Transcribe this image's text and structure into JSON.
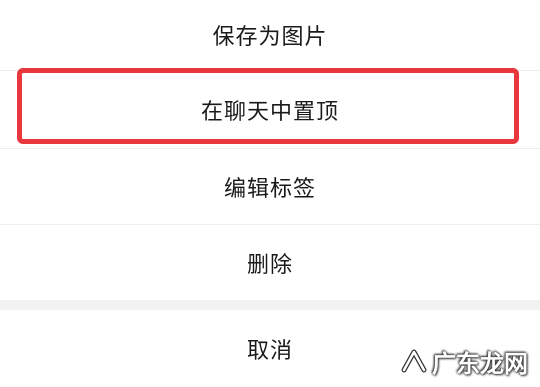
{
  "menu": {
    "items": [
      {
        "label": "保存为图片"
      },
      {
        "label": "在聊天中置顶"
      },
      {
        "label": "编辑标签"
      },
      {
        "label": "删除"
      }
    ],
    "cancel_label": "取消"
  },
  "highlight": {
    "color": "#e8383d",
    "target": "在聊天中置顶"
  },
  "watermark": {
    "text": "广东龙网"
  }
}
